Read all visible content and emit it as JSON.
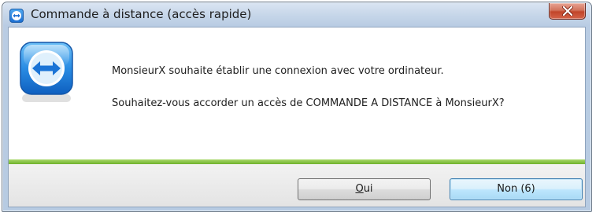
{
  "window": {
    "title": "Commande à distance (accès rapide)",
    "app_icon": "teamviewer-icon",
    "close_icon": "close-icon"
  },
  "message": {
    "line1": "MonsieurX souhaite établir une  connexion avec votre ordinateur.",
    "line2": "Souhaitez-vous accorder un accès de COMMANDE A DISTANCE à MonsieurX?"
  },
  "buttons": {
    "yes_accel": "O",
    "yes_rest": "ui",
    "no_label": "Non (6)"
  },
  "colors": {
    "accent_green": "#6fb22c",
    "brand_blue": "#1b6ed2",
    "close_red": "#c2452a"
  }
}
